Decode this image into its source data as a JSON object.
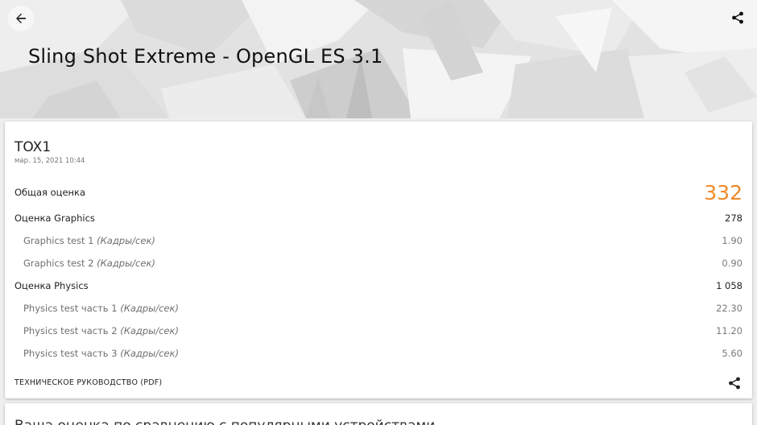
{
  "header": {
    "title": "Sling Shot Extreme - OpenGL ES 3.1",
    "back_icon": "arrow-left-icon",
    "share_icon": "share-icon"
  },
  "result": {
    "device": "TOX1",
    "date": "мар. 15, 2021 10:44",
    "total_label": "Общая оценка",
    "total_value": "332",
    "accent_color": "#ef8a27",
    "rows": [
      {
        "label": "Оценка Graphics",
        "unit": "",
        "value": "278"
      },
      {
        "label": "Graphics test 1 ",
        "unit": "(Кадры/сек)",
        "value": "1.90"
      },
      {
        "label": "Graphics test 2 ",
        "unit": "(Кадры/сек)",
        "value": "0.90"
      },
      {
        "label": "Оценка Physics",
        "unit": "",
        "value": "1 058"
      },
      {
        "label": "Physics test часть 1 ",
        "unit": "(Кадры/сек)",
        "value": "22.30"
      },
      {
        "label": "Physics test часть 2 ",
        "unit": "(Кадры/сек)",
        "value": "11.20"
      },
      {
        "label": "Physics test часть 3 ",
        "unit": "(Кадры/сек)",
        "value": "5.60"
      }
    ],
    "manual_link": "ТЕХНИЧЕСКОЕ РУКОВОДСТВО (PDF)"
  },
  "comparison": {
    "heading": "Ваша оценка по сравнению с популярными устройствами"
  }
}
